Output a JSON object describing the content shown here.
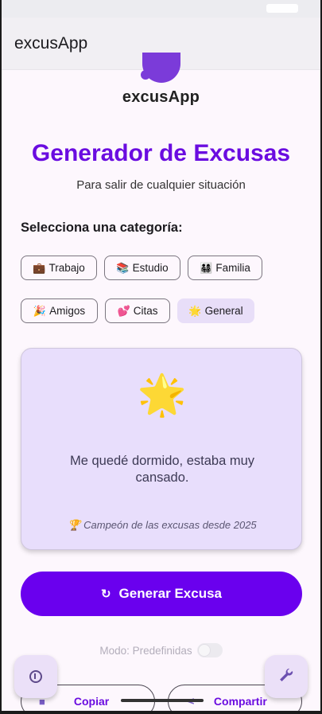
{
  "appbar": {
    "title": "excusApp"
  },
  "logo": {
    "text": "excusApp",
    "color": "#7b3bd9"
  },
  "header": {
    "title": "Generador de Excusas",
    "subtitle": "Para salir de cualquier situación",
    "title_color": "#6a0ce0"
  },
  "categories": {
    "heading": "Selecciona una categoría:",
    "items": [
      {
        "emoji": "💼",
        "label": "Trabajo",
        "selected": false
      },
      {
        "emoji": "📚",
        "label": "Estudio",
        "selected": false
      },
      {
        "emoji": "👨‍👩‍👧‍👦",
        "label": "Familia",
        "selected": false
      },
      {
        "emoji": "🎉",
        "label": "Amigos",
        "selected": false
      },
      {
        "emoji": "💕",
        "label": "Citas",
        "selected": false
      },
      {
        "emoji": "🌟",
        "label": "General",
        "selected": true
      }
    ]
  },
  "excuse_card": {
    "icon": "star-icon",
    "icon_glyph": "🌟",
    "text": "Me quedé dormido, estaba muy cansado.",
    "footer": "🏆 Campeón de las excusas desde 2025"
  },
  "generate_button": {
    "label": "Generar Excusa",
    "icon": "refresh-icon",
    "color": "#6a00ee"
  },
  "mode": {
    "label": "Modo: Predefinidas",
    "enabled": false
  },
  "bottom_actions": {
    "copy_label": "Copiar",
    "share_label": "Compartir"
  },
  "fabs": {
    "info_icon": "info-icon",
    "tools_icon": "wrench-icon"
  }
}
